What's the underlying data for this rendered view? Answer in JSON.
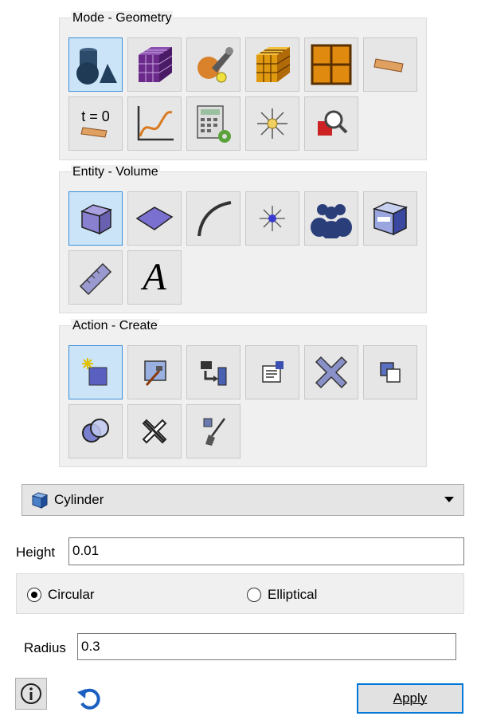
{
  "mode_group": {
    "title": "Mode - Geometry",
    "icons": [
      "geometry-shapes-icon",
      "hex-mesh-icon",
      "tool-settings-icon",
      "gold-mesh-cube-icon",
      "grid-surface-icon",
      "sheet-strip-icon",
      "initial-condition-icon",
      "xy-plot-icon",
      "calculator-icon",
      "starburst-icon",
      "zoom-locate-icon"
    ],
    "initial_condition_text": "t = 0"
  },
  "entity_group": {
    "title": "Entity - Volume",
    "icons": [
      "volume-cube-icon",
      "surface-icon",
      "curve-icon",
      "vertex-icon",
      "group-icon",
      "body-icon",
      "measure-ruler-icon",
      "text-annotation-icon"
    ],
    "text_glyph": "A"
  },
  "action_group": {
    "title": "Action - Create",
    "icons": [
      "create-icon",
      "modify-icon",
      "transform-icon",
      "properties-icon",
      "delete-icon",
      "copy-icon",
      "boolean-icon",
      "decompose-icon",
      "cleanup-icon"
    ]
  },
  "shape_select": {
    "value": "Cylinder"
  },
  "height": {
    "label": "Height",
    "value": "0.01"
  },
  "radio_options": {
    "circular": "Circular",
    "elliptical": "Elliptical",
    "selected": "circular"
  },
  "radius": {
    "label": "Radius",
    "value": "0.3"
  },
  "footer": {
    "apply_label": "Apply"
  },
  "colors": {
    "accent": "#0078d7",
    "selected_tile": "#cce4f7",
    "panel": "#f0f0f0"
  }
}
